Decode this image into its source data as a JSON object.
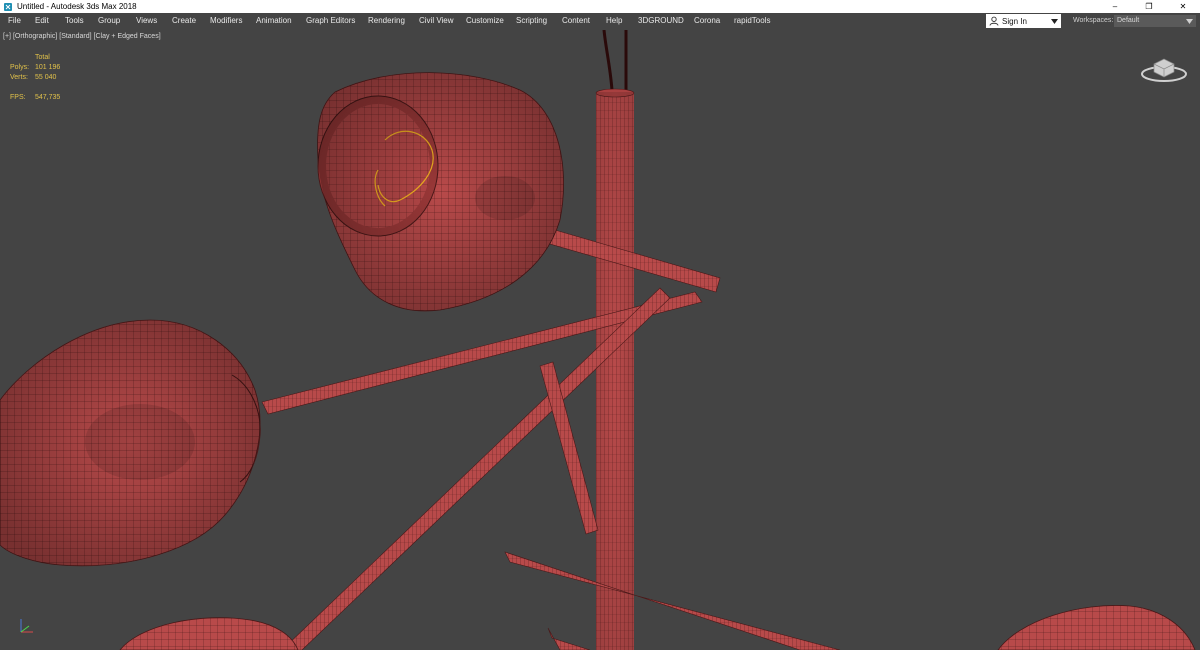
{
  "window": {
    "title": "Untitled - Autodesk 3ds Max 2018",
    "app_icon": "3dsmax-icon",
    "controls": {
      "minimize": "–",
      "maximize": "❐",
      "close": "✕"
    }
  },
  "menubar": {
    "items": [
      {
        "label": "File"
      },
      {
        "label": "Edit"
      },
      {
        "label": "Tools"
      },
      {
        "label": "Group"
      },
      {
        "label": "Views"
      },
      {
        "label": "Create"
      },
      {
        "label": "Modifiers"
      },
      {
        "label": "Animation"
      },
      {
        "label": "Graph Editors"
      },
      {
        "label": "Rendering"
      },
      {
        "label": "Civil View"
      },
      {
        "label": "Customize"
      },
      {
        "label": "Scripting"
      },
      {
        "label": "Content"
      },
      {
        "label": "Help"
      },
      {
        "label": "3DGROUND"
      },
      {
        "label": "Corona"
      },
      {
        "label": "rapidTools"
      }
    ],
    "signin": {
      "label": "Sign In",
      "icon": "user-icon"
    },
    "workspaces": {
      "label": "Workspaces:",
      "value": "Default"
    }
  },
  "viewport": {
    "label_plus": "[+]",
    "label_view": "[Orthographic]",
    "label_shading": "[Standard]",
    "label_style": "[Clay + Edged Faces]",
    "stats": {
      "header": "Total",
      "polys_label": "Polys:",
      "polys_value": "101 196",
      "verts_label": "Verts:",
      "verts_value": "55 040",
      "fps_label": "FPS:",
      "fps_value": "547,735"
    },
    "colors": {
      "background": "#444444",
      "mesh": "#b84a4a",
      "wire": "#4a1818",
      "stats_text": "#e2c24a",
      "selection": "#f0b020"
    }
  }
}
